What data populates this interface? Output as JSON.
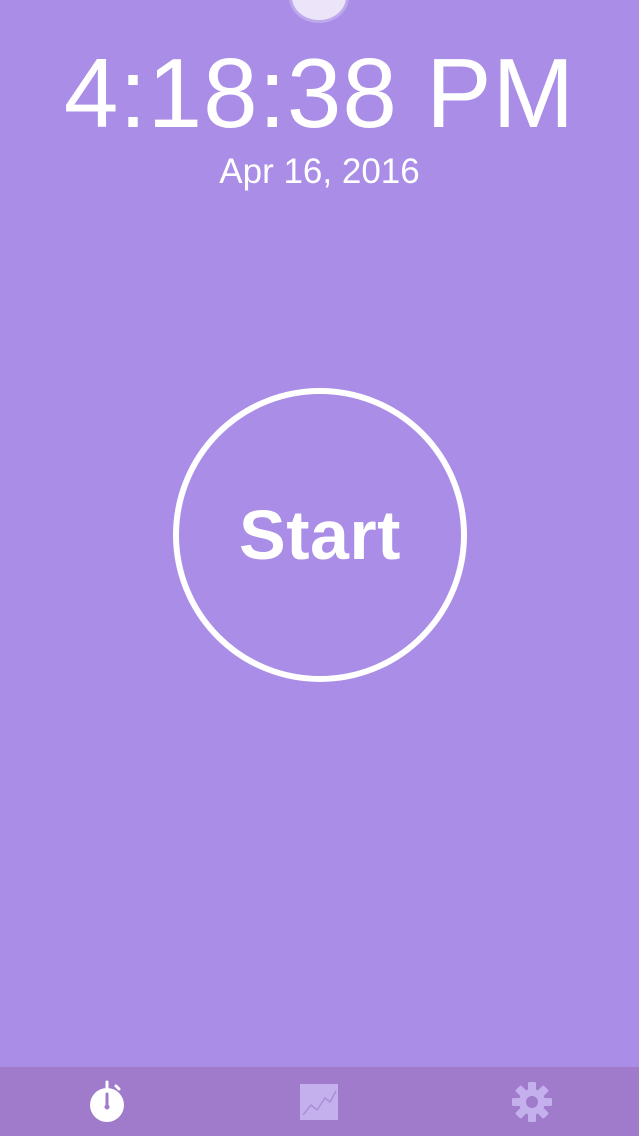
{
  "clock": {
    "time": "4:18:38 PM",
    "date": "Apr 16, 2016"
  },
  "main": {
    "start_label": "Start"
  },
  "tab_bar": {
    "tabs": [
      {
        "id": "timer",
        "icon": "stopwatch-icon",
        "selected": true
      },
      {
        "id": "stats",
        "icon": "chart-icon",
        "selected": false
      },
      {
        "id": "settings",
        "icon": "gear-icon",
        "selected": false
      }
    ]
  },
  "colors": {
    "background": "#a98de6",
    "tab_bar": "#a07acb",
    "foreground": "#ffffff",
    "inactive_icon": "#c5b0ee"
  }
}
